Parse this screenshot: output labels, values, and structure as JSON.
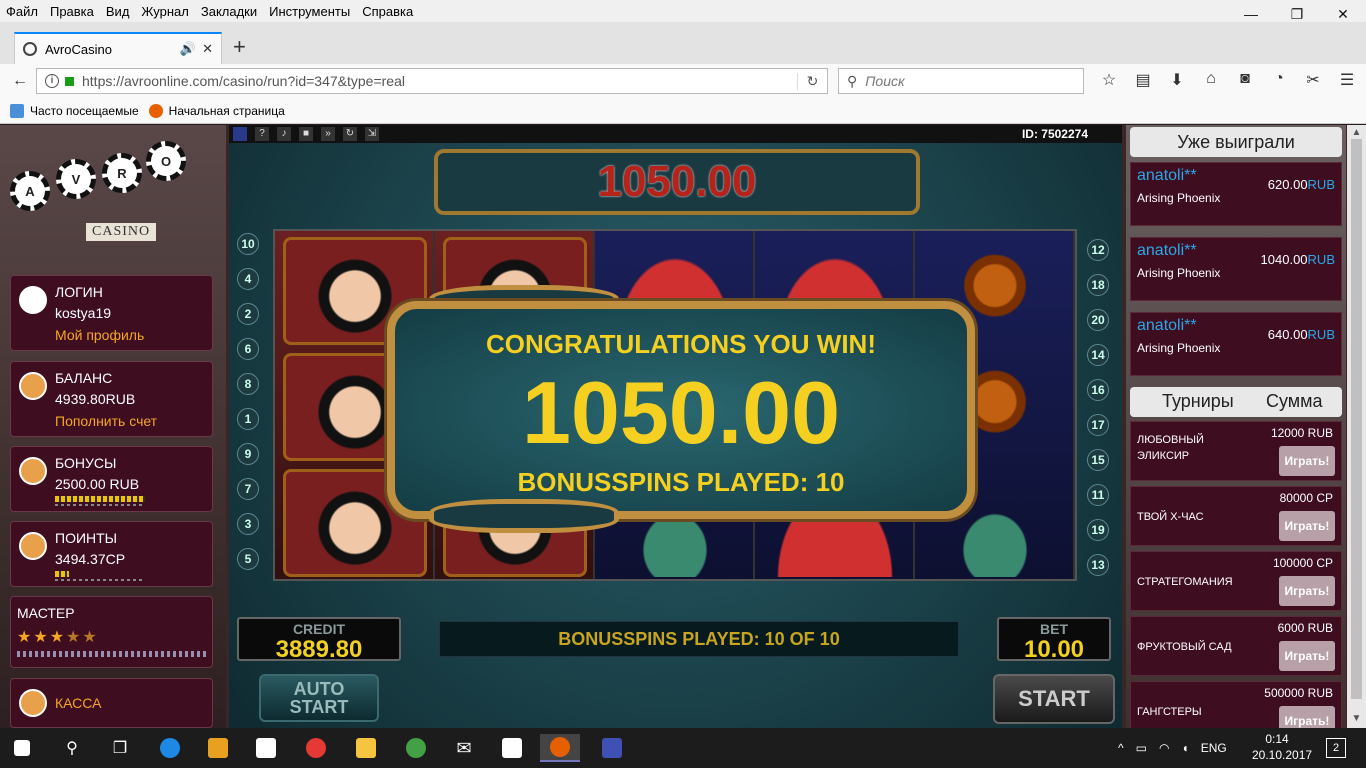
{
  "menu": [
    "Файл",
    "Правка",
    "Вид",
    "Журнал",
    "Закладки",
    "Инструменты",
    "Справка"
  ],
  "tab": {
    "title": "AvroCasino"
  },
  "url": "https://avroonline.com/casino/run?id=347&type=real",
  "search_placeholder": "Поиск",
  "bookmarks": {
    "frequent": "Часто посещаемые",
    "home": "Начальная страница"
  },
  "logo": {
    "letters": [
      "A",
      "V",
      "R",
      "O"
    ],
    "text": "CASINO"
  },
  "login": {
    "title": "ЛОГИН",
    "user": "kostya19",
    "link": "Мой профиль"
  },
  "balance": {
    "title": "БАЛАНС",
    "value": "4939.80RUB",
    "link": "Пополнить счет"
  },
  "bonus": {
    "title": "БОНУСЫ",
    "value": "2500.00 RUB"
  },
  "points": {
    "title": "ПОИНТЫ",
    "value": "3494.37CP"
  },
  "master": {
    "title": "МАСТЕР",
    "stars_on": "★★★",
    "stars_off": "★★",
    "rating": 3,
    "rating_max": 5
  },
  "kassa": {
    "title": "КАССА"
  },
  "game": {
    "id": "ID: 7502274",
    "top_win": "1050.00",
    "left_numbers": [
      "10",
      "4",
      "2",
      "6",
      "8",
      "1",
      "9",
      "7",
      "3",
      "5"
    ],
    "right_numbers": [
      "12",
      "18",
      "20",
      "14",
      "16",
      "17",
      "15",
      "11",
      "19",
      "13"
    ],
    "popup": {
      "title": "CONGRATULATIONS YOU WIN!",
      "amount": "1050.00",
      "sub": "BONUSSPINS PLAYED: 10"
    },
    "credit_label": "CREDIT",
    "credit": "3889.80",
    "message": "BONUSSPINS PLAYED: 10 OF 10",
    "bet_label": "BET",
    "bet": "10.00",
    "auto1": "AUTO",
    "auto2": "START",
    "start": "START"
  },
  "winners": {
    "title": "Уже выиграли",
    "items": [
      {
        "user": "anatoli**",
        "game": "Arising Phoenix",
        "amount": "620.00",
        "cur": "RUB"
      },
      {
        "user": "anatoli**",
        "game": "Arising Phoenix",
        "amount": "1040.00",
        "cur": "RUB"
      },
      {
        "user": "anatoli**",
        "game": "Arising Phoenix",
        "amount": "640.00",
        "cur": "RUB"
      }
    ]
  },
  "tournaments": {
    "col1": "Турниры",
    "col2": "Сумма",
    "items": [
      {
        "name": "ЛЮБОВНЫЙ ЭЛИКСИР",
        "sum": "12000 RUB",
        "btn": "Играть!"
      },
      {
        "name": "ТВОЙ Х-ЧАС",
        "sum": "80000 CP",
        "btn": "Играть!"
      },
      {
        "name": "СТРАТЕГОМАНИЯ",
        "sum": "100000 CP",
        "btn": "Играть!"
      },
      {
        "name": "ФРУКТОВЫЙ САД",
        "sum": "6000 RUB",
        "btn": "Играть!"
      },
      {
        "name": "ГАНГСТЕРЫ",
        "sum": "500000 RUB",
        "btn": "Играть!"
      }
    ]
  },
  "taskbar": {
    "lang": "ENG",
    "time": "0:14",
    "date": "20.10.2017",
    "notifications": "2"
  }
}
